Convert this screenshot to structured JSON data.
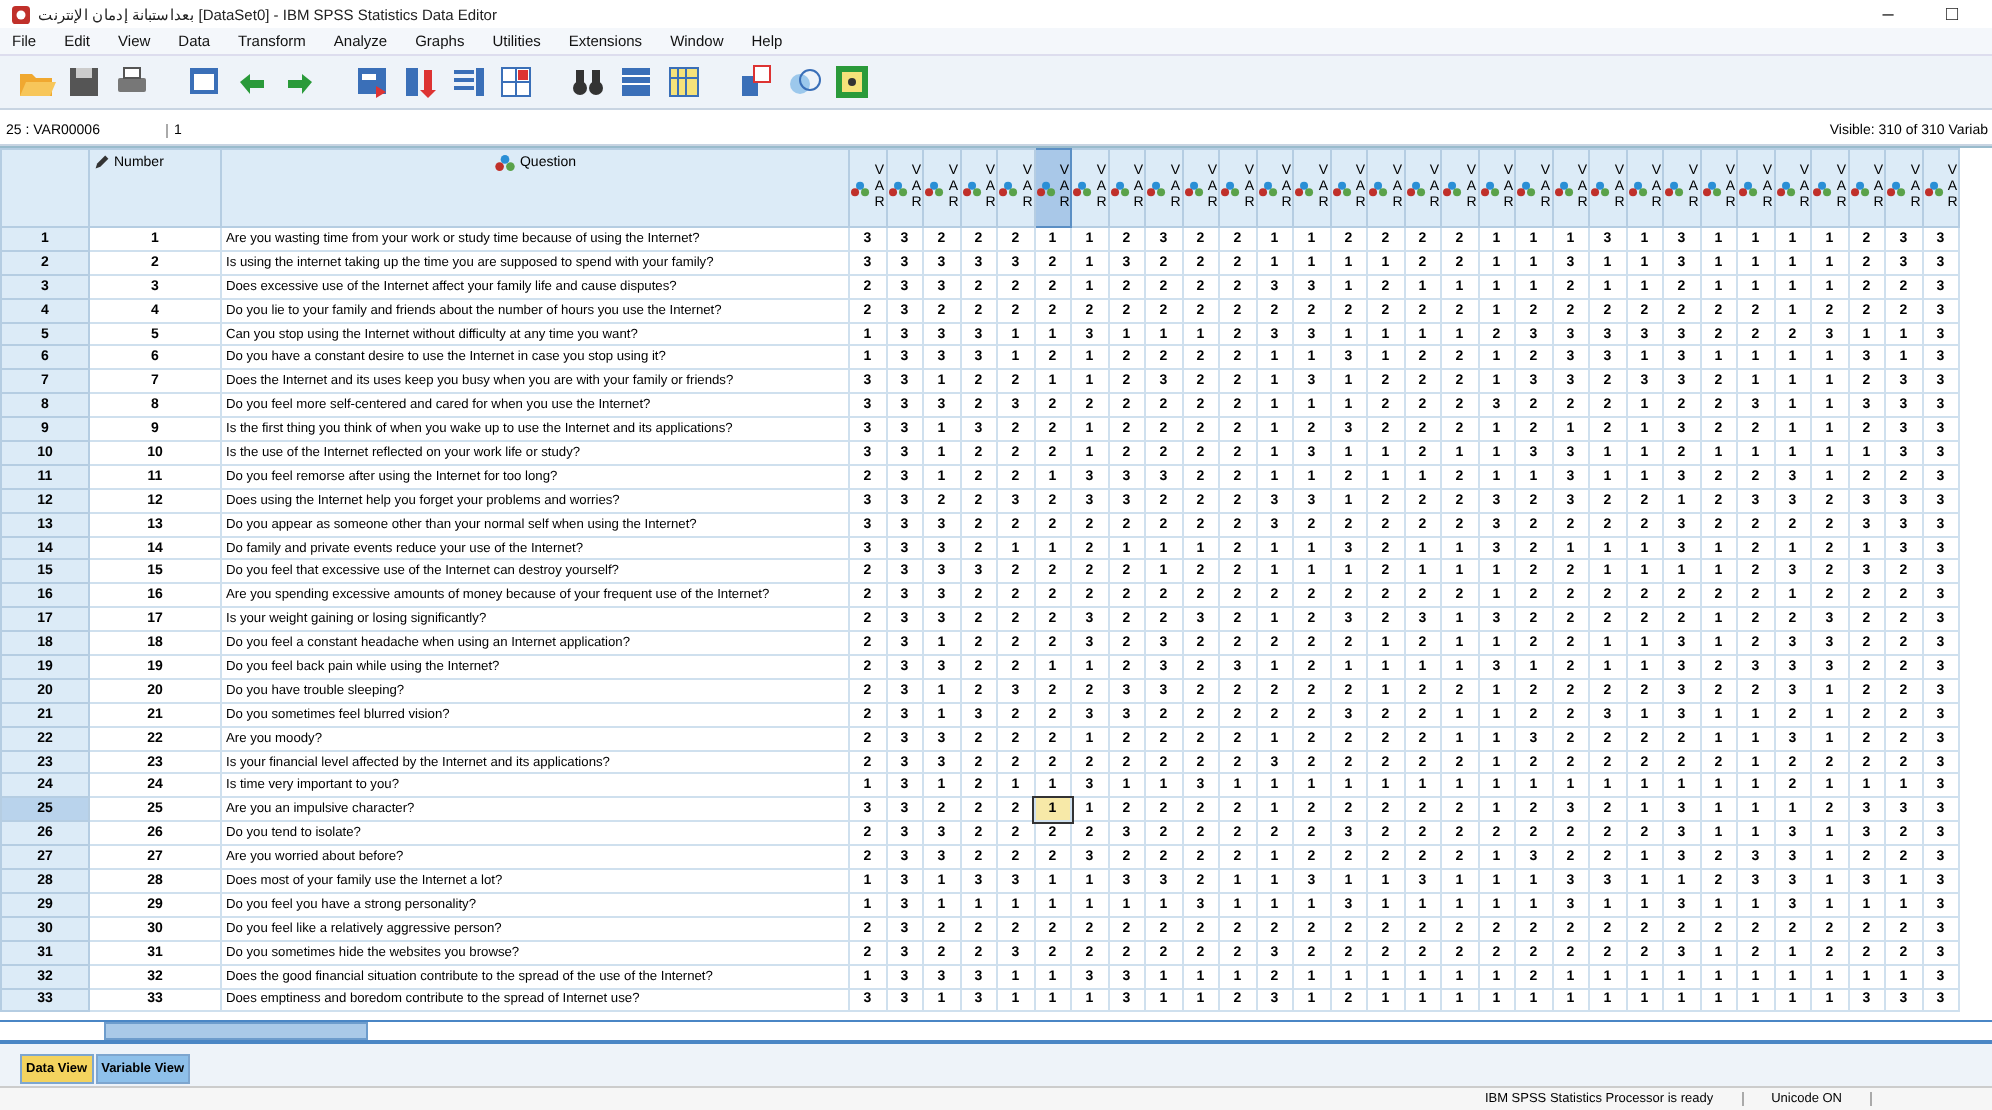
{
  "window": {
    "title": "بعداستبانة إدمان الإنترنت [DataSet0] - IBM SPSS Statistics Data Editor",
    "controls": [
      "–",
      "□"
    ]
  },
  "menu": [
    "File",
    "Edit",
    "View",
    "Data",
    "Transform",
    "Analyze",
    "Graphs",
    "Utilities",
    "Extensions",
    "Window",
    "Help"
  ],
  "cell_editor": {
    "reference": "25 : VAR00006",
    "value": "1",
    "visible": "Visible: 310 of 310 Variab"
  },
  "grid": {
    "columns": [
      {
        "label": "Number",
        "kind": "scale"
      },
      {
        "label": "Question",
        "kind": "nominal"
      }
    ],
    "variables": [
      {
        "label": "VAR",
        "selected": false
      },
      {
        "label": "VAR",
        "selected": false
      },
      {
        "label": "VAR",
        "selected": false
      },
      {
        "label": "VAR",
        "selected": false
      },
      {
        "label": "VAR",
        "selected": false
      },
      {
        "label": "VAR",
        "selected": true
      },
      {
        "label": "VAR",
        "selected": false
      },
      {
        "label": "VAR",
        "selected": false
      },
      {
        "label": "VAR",
        "selected": false
      },
      {
        "label": "VAR",
        "selected": false
      },
      {
        "label": "VAR",
        "selected": false
      },
      {
        "label": "VAR",
        "selected": false
      },
      {
        "label": "VAR",
        "selected": false
      },
      {
        "label": "VAR",
        "selected": false
      },
      {
        "label": "VAR",
        "selected": false
      },
      {
        "label": "VAR",
        "selected": false
      },
      {
        "label": "VAR",
        "selected": false
      },
      {
        "label": "VAR",
        "selected": false
      },
      {
        "label": "VAR",
        "selected": false
      },
      {
        "label": "VAR",
        "selected": false
      },
      {
        "label": "VAR",
        "selected": false
      },
      {
        "label": "VAR",
        "selected": false
      },
      {
        "label": "VAR",
        "selected": false
      },
      {
        "label": "VAR",
        "selected": false
      },
      {
        "label": "VAR",
        "selected": false
      },
      {
        "label": "VAR",
        "selected": false
      },
      {
        "label": "VAR",
        "selected": false
      },
      {
        "label": "VAR",
        "selected": false
      },
      {
        "label": "VAR",
        "selected": false
      },
      {
        "label": "VAR",
        "selected": false
      }
    ],
    "rows": [
      {
        "case": "1",
        "number": "1",
        "question": "Are you wasting time from your work or study time because of using the Internet?",
        "selected": false,
        "values": [
          "3",
          "3",
          "2",
          "2",
          "2",
          "1",
          "1",
          "2",
          "3",
          "2",
          "2",
          "1",
          "1",
          "2",
          "2",
          "2",
          "2",
          "1",
          "1",
          "1",
          "3",
          "1",
          "3",
          "1",
          "1",
          "1",
          "1",
          "2",
          "3",
          "3"
        ]
      },
      {
        "case": "2",
        "number": "2",
        "question": "Is using the internet taking up the time you are supposed to spend with your family?",
        "selected": false,
        "values": [
          "3",
          "3",
          "3",
          "3",
          "3",
          "2",
          "1",
          "3",
          "2",
          "2",
          "2",
          "1",
          "1",
          "1",
          "1",
          "2",
          "2",
          "1",
          "1",
          "3",
          "1",
          "1",
          "3",
          "1",
          "1",
          "1",
          "1",
          "2",
          "3",
          "3"
        ]
      },
      {
        "case": "3",
        "number": "3",
        "question": "Does excessive use of the Internet affect your family life and cause disputes?",
        "selected": false,
        "values": [
          "2",
          "3",
          "3",
          "2",
          "2",
          "2",
          "1",
          "2",
          "2",
          "2",
          "2",
          "3",
          "3",
          "1",
          "2",
          "1",
          "1",
          "1",
          "1",
          "2",
          "1",
          "1",
          "2",
          "1",
          "1",
          "1",
          "1",
          "2",
          "2",
          "3"
        ]
      },
      {
        "case": "4",
        "number": "4",
        "question": "Do you lie to your family and friends about the number of hours you use the Internet?",
        "selected": false,
        "values": [
          "2",
          "3",
          "2",
          "2",
          "2",
          "2",
          "2",
          "2",
          "2",
          "2",
          "2",
          "2",
          "2",
          "2",
          "2",
          "2",
          "2",
          "1",
          "2",
          "2",
          "2",
          "2",
          "2",
          "2",
          "2",
          "1",
          "2",
          "2",
          "2",
          "3"
        ]
      },
      {
        "case": "5",
        "number": "5",
        "question": "Can you stop using the Internet without difficulty at any time you want?",
        "selected": false,
        "values": [
          "1",
          "3",
          "3",
          "3",
          "1",
          "1",
          "3",
          "1",
          "1",
          "1",
          "2",
          "3",
          "3",
          "1",
          "1",
          "1",
          "1",
          "2",
          "3",
          "3",
          "3",
          "3",
          "3",
          "2",
          "2",
          "2",
          "3",
          "1",
          "1",
          "3"
        ]
      },
      {
        "case": "6",
        "number": "6",
        "question": "Do you have a constant desire to use the Internet in case you stop using it?",
        "selected": false,
        "values": [
          "1",
          "3",
          "3",
          "3",
          "1",
          "2",
          "1",
          "2",
          "2",
          "2",
          "2",
          "1",
          "1",
          "3",
          "1",
          "2",
          "2",
          "1",
          "2",
          "3",
          "3",
          "1",
          "3",
          "1",
          "1",
          "1",
          "1",
          "3",
          "1",
          "3"
        ]
      },
      {
        "case": "7",
        "number": "7",
        "question": "Does the Internet and its uses keep you busy when you are with your family or friends?",
        "selected": false,
        "values": [
          "3",
          "3",
          "1",
          "2",
          "2",
          "1",
          "1",
          "2",
          "3",
          "2",
          "2",
          "1",
          "3",
          "1",
          "2",
          "2",
          "2",
          "1",
          "3",
          "3",
          "2",
          "3",
          "3",
          "2",
          "1",
          "1",
          "1",
          "2",
          "3",
          "3"
        ]
      },
      {
        "case": "8",
        "number": "8",
        "question": "Do you feel more self-centered and cared for when you use the Internet?",
        "selected": false,
        "values": [
          "3",
          "3",
          "3",
          "2",
          "3",
          "2",
          "2",
          "2",
          "2",
          "2",
          "2",
          "1",
          "1",
          "1",
          "2",
          "2",
          "2",
          "3",
          "2",
          "2",
          "2",
          "1",
          "2",
          "2",
          "3",
          "1",
          "1",
          "3",
          "3",
          "3"
        ]
      },
      {
        "case": "9",
        "number": "9",
        "question": "Is the first thing you think of when you wake up to use the Internet and its applications?",
        "selected": false,
        "values": [
          "3",
          "3",
          "1",
          "3",
          "2",
          "2",
          "1",
          "2",
          "2",
          "2",
          "2",
          "1",
          "2",
          "3",
          "2",
          "2",
          "2",
          "1",
          "2",
          "1",
          "2",
          "1",
          "3",
          "2",
          "2",
          "1",
          "1",
          "2",
          "3",
          "3"
        ]
      },
      {
        "case": "10",
        "number": "10",
        "question": "Is the use of the Internet reflected on your work life or study?",
        "selected": false,
        "values": [
          "3",
          "3",
          "1",
          "2",
          "2",
          "2",
          "1",
          "2",
          "2",
          "2",
          "2",
          "1",
          "3",
          "1",
          "1",
          "2",
          "1",
          "1",
          "3",
          "3",
          "1",
          "1",
          "2",
          "1",
          "1",
          "1",
          "1",
          "1",
          "3",
          "3"
        ]
      },
      {
        "case": "11",
        "number": "11",
        "question": "Do you feel remorse after using the Internet for too long?",
        "selected": false,
        "values": [
          "2",
          "3",
          "1",
          "2",
          "2",
          "1",
          "3",
          "3",
          "3",
          "2",
          "2",
          "1",
          "1",
          "2",
          "1",
          "1",
          "2",
          "1",
          "1",
          "3",
          "1",
          "1",
          "3",
          "2",
          "2",
          "3",
          "1",
          "2",
          "2",
          "3"
        ]
      },
      {
        "case": "12",
        "number": "12",
        "question": "Does using the Internet help you forget your problems and worries?",
        "selected": false,
        "values": [
          "3",
          "3",
          "2",
          "2",
          "3",
          "2",
          "3",
          "3",
          "2",
          "2",
          "2",
          "3",
          "3",
          "1",
          "2",
          "2",
          "2",
          "3",
          "2",
          "3",
          "2",
          "2",
          "1",
          "2",
          "3",
          "3",
          "2",
          "3",
          "3",
          "3"
        ]
      },
      {
        "case": "13",
        "number": "13",
        "question": "Do you appear as someone other than your normal self when using the Internet?",
        "selected": false,
        "values": [
          "3",
          "3",
          "3",
          "2",
          "2",
          "2",
          "2",
          "2",
          "2",
          "2",
          "2",
          "3",
          "2",
          "2",
          "2",
          "2",
          "2",
          "3",
          "2",
          "2",
          "2",
          "2",
          "3",
          "2",
          "2",
          "2",
          "2",
          "3",
          "3",
          "3"
        ]
      },
      {
        "case": "14",
        "number": "14",
        "question": "Do family and private events reduce your use of the Internet?",
        "selected": false,
        "values": [
          "3",
          "3",
          "3",
          "2",
          "1",
          "1",
          "2",
          "1",
          "1",
          "1",
          "2",
          "1",
          "1",
          "3",
          "2",
          "1",
          "1",
          "3",
          "2",
          "1",
          "1",
          "1",
          "3",
          "1",
          "2",
          "1",
          "2",
          "1",
          "3",
          "3"
        ]
      },
      {
        "case": "15",
        "number": "15",
        "question": "Do you feel that excessive use of the Internet can destroy yourself?",
        "selected": false,
        "values": [
          "2",
          "3",
          "3",
          "3",
          "2",
          "2",
          "2",
          "2",
          "1",
          "2",
          "2",
          "1",
          "1",
          "1",
          "2",
          "1",
          "1",
          "1",
          "2",
          "2",
          "1",
          "1",
          "1",
          "1",
          "2",
          "3",
          "2",
          "3",
          "2",
          "3"
        ]
      },
      {
        "case": "16",
        "number": "16",
        "question": "Are you spending excessive amounts of money because of your frequent use of the Internet?",
        "selected": false,
        "values": [
          "2",
          "3",
          "3",
          "2",
          "2",
          "2",
          "2",
          "2",
          "2",
          "2",
          "2",
          "2",
          "2",
          "2",
          "2",
          "2",
          "2",
          "1",
          "2",
          "2",
          "2",
          "2",
          "2",
          "2",
          "2",
          "1",
          "2",
          "2",
          "2",
          "3"
        ]
      },
      {
        "case": "17",
        "number": "17",
        "question": "Is your weight gaining or losing significantly?",
        "selected": false,
        "values": [
          "2",
          "3",
          "3",
          "2",
          "2",
          "2",
          "3",
          "2",
          "2",
          "3",
          "2",
          "1",
          "2",
          "3",
          "2",
          "3",
          "1",
          "3",
          "2",
          "2",
          "2",
          "2",
          "2",
          "1",
          "2",
          "2",
          "3",
          "2",
          "2",
          "3"
        ]
      },
      {
        "case": "18",
        "number": "18",
        "question": "Do you feel a constant headache when using an Internet application?",
        "selected": false,
        "values": [
          "2",
          "3",
          "1",
          "2",
          "2",
          "2",
          "3",
          "2",
          "3",
          "2",
          "2",
          "2",
          "2",
          "2",
          "1",
          "2",
          "1",
          "1",
          "2",
          "2",
          "1",
          "1",
          "3",
          "1",
          "2",
          "3",
          "3",
          "2",
          "2",
          "3"
        ]
      },
      {
        "case": "19",
        "number": "19",
        "question": "Do you feel back pain while using the Internet?",
        "selected": false,
        "values": [
          "2",
          "3",
          "3",
          "2",
          "2",
          "1",
          "1",
          "2",
          "3",
          "2",
          "3",
          "1",
          "2",
          "1",
          "1",
          "1",
          "1",
          "3",
          "1",
          "2",
          "1",
          "1",
          "3",
          "2",
          "3",
          "3",
          "3",
          "2",
          "2",
          "3"
        ]
      },
      {
        "case": "20",
        "number": "20",
        "question": "Do you have trouble sleeping?",
        "selected": false,
        "values": [
          "2",
          "3",
          "1",
          "2",
          "3",
          "2",
          "2",
          "3",
          "3",
          "2",
          "2",
          "2",
          "2",
          "2",
          "1",
          "2",
          "2",
          "1",
          "2",
          "2",
          "2",
          "2",
          "3",
          "2",
          "2",
          "3",
          "1",
          "2",
          "2",
          "3"
        ]
      },
      {
        "case": "21",
        "number": "21",
        "question": "Do you sometimes feel blurred vision?",
        "selected": false,
        "values": [
          "2",
          "3",
          "1",
          "3",
          "2",
          "2",
          "3",
          "3",
          "2",
          "2",
          "2",
          "2",
          "2",
          "3",
          "2",
          "2",
          "1",
          "1",
          "2",
          "2",
          "3",
          "1",
          "3",
          "1",
          "1",
          "2",
          "1",
          "2",
          "2",
          "3"
        ]
      },
      {
        "case": "22",
        "number": "22",
        "question": "Are you moody?",
        "selected": false,
        "values": [
          "2",
          "3",
          "3",
          "2",
          "2",
          "2",
          "1",
          "2",
          "2",
          "2",
          "2",
          "1",
          "2",
          "2",
          "2",
          "2",
          "1",
          "1",
          "3",
          "2",
          "2",
          "2",
          "2",
          "1",
          "1",
          "3",
          "1",
          "2",
          "2",
          "3"
        ]
      },
      {
        "case": "23",
        "number": "23",
        "question": "Is your financial level affected by the Internet and its applications?",
        "selected": false,
        "values": [
          "2",
          "3",
          "3",
          "2",
          "2",
          "2",
          "2",
          "2",
          "2",
          "2",
          "2",
          "3",
          "2",
          "2",
          "2",
          "2",
          "2",
          "1",
          "2",
          "2",
          "2",
          "2",
          "2",
          "2",
          "1",
          "2",
          "2",
          "2",
          "2",
          "3"
        ]
      },
      {
        "case": "24",
        "number": "24",
        "question": "Is time very important to you?",
        "selected": false,
        "values": [
          "1",
          "3",
          "1",
          "2",
          "1",
          "1",
          "3",
          "1",
          "1",
          "3",
          "1",
          "1",
          "1",
          "1",
          "1",
          "1",
          "1",
          "1",
          "1",
          "1",
          "1",
          "1",
          "1",
          "1",
          "1",
          "2",
          "1",
          "1",
          "1",
          "3"
        ]
      },
      {
        "case": "25",
        "number": "25",
        "question": "Are you an impulsive character?",
        "selected": true,
        "values": [
          "3",
          "3",
          "2",
          "2",
          "2",
          "1",
          "1",
          "2",
          "2",
          "2",
          "2",
          "1",
          "2",
          "2",
          "2",
          "2",
          "2",
          "1",
          "2",
          "3",
          "2",
          "1",
          "3",
          "1",
          "1",
          "1",
          "2",
          "3",
          "3",
          "3"
        ]
      },
      {
        "case": "26",
        "number": "26",
        "question": "Do you tend to isolate?",
        "selected": false,
        "values": [
          "2",
          "3",
          "3",
          "2",
          "2",
          "2",
          "2",
          "3",
          "2",
          "2",
          "2",
          "2",
          "2",
          "3",
          "2",
          "2",
          "2",
          "2",
          "2",
          "2",
          "2",
          "2",
          "3",
          "1",
          "1",
          "3",
          "1",
          "3",
          "2",
          "3"
        ]
      },
      {
        "case": "27",
        "number": "27",
        "question": "Are you worried about before?",
        "selected": false,
        "values": [
          "2",
          "3",
          "3",
          "2",
          "2",
          "2",
          "3",
          "2",
          "2",
          "2",
          "2",
          "1",
          "2",
          "2",
          "2",
          "2",
          "2",
          "1",
          "3",
          "2",
          "2",
          "1",
          "3",
          "2",
          "3",
          "3",
          "1",
          "2",
          "2",
          "3"
        ]
      },
      {
        "case": "28",
        "number": "28",
        "question": "Does most of your family use the Internet a lot?",
        "selected": false,
        "values": [
          "1",
          "3",
          "1",
          "3",
          "3",
          "1",
          "1",
          "3",
          "3",
          "2",
          "1",
          "1",
          "3",
          "1",
          "1",
          "3",
          "1",
          "1",
          "1",
          "3",
          "3",
          "1",
          "1",
          "2",
          "3",
          "3",
          "1",
          "3",
          "1",
          "3"
        ]
      },
      {
        "case": "29",
        "number": "29",
        "question": "Do you feel you have a strong personality?",
        "selected": false,
        "values": [
          "1",
          "3",
          "1",
          "1",
          "1",
          "1",
          "1",
          "1",
          "1",
          "3",
          "1",
          "1",
          "1",
          "3",
          "1",
          "1",
          "1",
          "1",
          "1",
          "3",
          "1",
          "1",
          "3",
          "1",
          "1",
          "3",
          "1",
          "1",
          "1",
          "3"
        ]
      },
      {
        "case": "30",
        "number": "30",
        "question": "Do you feel like a relatively aggressive person?",
        "selected": false,
        "values": [
          "2",
          "3",
          "2",
          "2",
          "2",
          "2",
          "2",
          "2",
          "2",
          "2",
          "2",
          "2",
          "2",
          "2",
          "2",
          "2",
          "2",
          "2",
          "2",
          "2",
          "2",
          "2",
          "2",
          "2",
          "2",
          "2",
          "2",
          "2",
          "2",
          "3"
        ]
      },
      {
        "case": "31",
        "number": "31",
        "question": "Do you sometimes hide the websites you browse?",
        "selected": false,
        "values": [
          "2",
          "3",
          "2",
          "2",
          "3",
          "2",
          "2",
          "2",
          "2",
          "2",
          "2",
          "3",
          "2",
          "2",
          "2",
          "2",
          "2",
          "2",
          "2",
          "2",
          "2",
          "2",
          "3",
          "1",
          "2",
          "1",
          "2",
          "2",
          "2",
          "3"
        ]
      },
      {
        "case": "32",
        "number": "32",
        "question": "Does the good financial situation contribute to the spread of the use of the Internet?",
        "selected": false,
        "values": [
          "1",
          "3",
          "3",
          "3",
          "1",
          "1",
          "3",
          "3",
          "1",
          "1",
          "1",
          "2",
          "1",
          "1",
          "1",
          "1",
          "1",
          "1",
          "2",
          "1",
          "1",
          "1",
          "1",
          "1",
          "1",
          "1",
          "1",
          "1",
          "1",
          "3"
        ]
      },
      {
        "case": "33",
        "number": "33",
        "question": "Does emptiness and boredom contribute to the spread of Internet use?",
        "selected": false,
        "values": [
          "3",
          "3",
          "1",
          "3",
          "1",
          "1",
          "1",
          "3",
          "1",
          "1",
          "2",
          "3",
          "1",
          "2",
          "1",
          "1",
          "1",
          "1",
          "1",
          "1",
          "1",
          "1",
          "1",
          "1",
          "1",
          "1",
          "1",
          "3",
          "3",
          "3"
        ]
      }
    ]
  },
  "tabs": [
    {
      "label": "Data View",
      "selected": true
    },
    {
      "label": "Variable View",
      "selected": false
    }
  ],
  "status_bar": [
    "IBM SPSS Statistics Processor is ready",
    "Unicode ON"
  ]
}
